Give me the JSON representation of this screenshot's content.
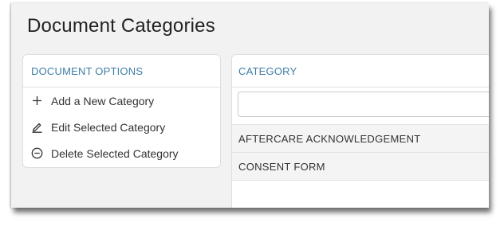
{
  "page": {
    "title": "Document Categories"
  },
  "options": {
    "header": "DOCUMENT OPTIONS",
    "items": [
      {
        "label": "Add a New Category",
        "icon": "plus-icon"
      },
      {
        "label": "Edit Selected Category",
        "icon": "pencil-icon"
      },
      {
        "label": "Delete Selected Category",
        "icon": "minus-circle-icon"
      }
    ]
  },
  "categories": {
    "header": "CATEGORY",
    "filter_value": "",
    "filter_placeholder": "",
    "rows": [
      "AFTERCARE ACKNOWLEDGEMENT",
      "CONSENT FORM"
    ]
  },
  "colors": {
    "header_text": "#3d7ea6",
    "background": "#f2f2f2",
    "card": "#ffffff"
  }
}
